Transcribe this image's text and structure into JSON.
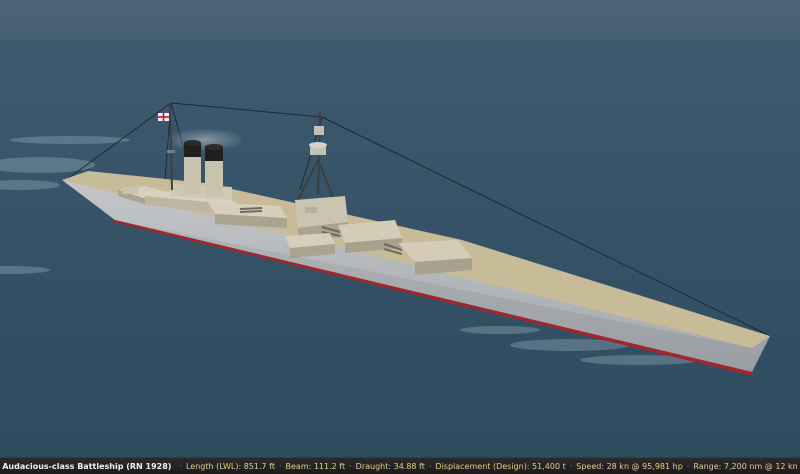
{
  "scene": {
    "subject": "battleship-model",
    "colors": {
      "sea": "#345268",
      "sea_far": "#3f5a6e",
      "sky": "#4a6276",
      "hull": "#b9bbbd",
      "hull_shadow": "#9a9ea2",
      "deck": "#c9bd9c",
      "boot_top": "#a3262b",
      "superstructure": "#cfc8b4",
      "funnel": "#1f1f1f",
      "rigging": "#1d2a33"
    },
    "flag_icon": "white-ensign-flag-icon"
  },
  "statusbar": {
    "ship_title": "Audacious-class Battleship (RN 1928)",
    "separator": "·",
    "specs": [
      "Length (LWL): 851.7 ft",
      "Beam: 111.2 ft",
      "Draught: 34.88 ft",
      "Displacement (Design): 51,400 t",
      "Speed: 28 kn @ 95,981 hp",
      "Range: 7,200 nm @ 12 kn"
    ]
  }
}
